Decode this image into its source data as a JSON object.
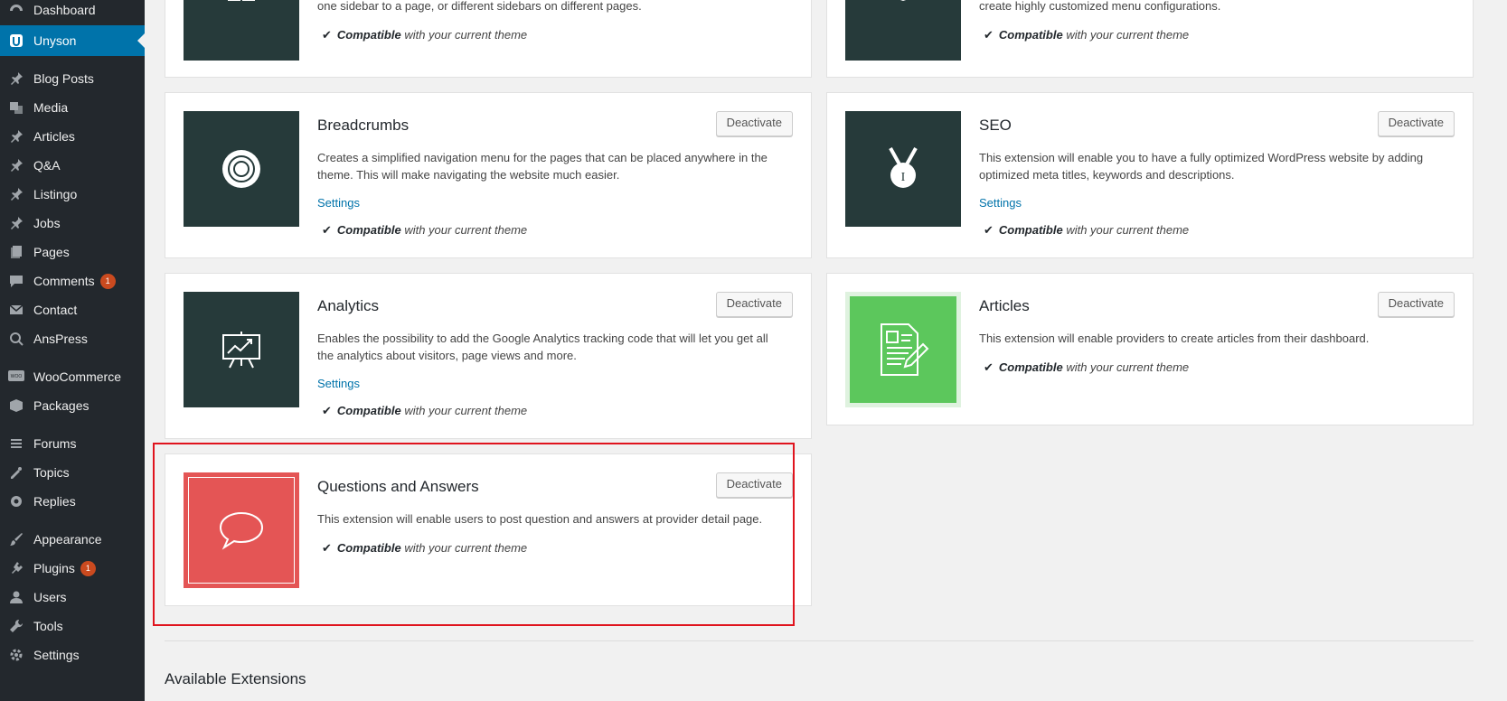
{
  "sidebar": {
    "items": [
      {
        "label": "Dashboard",
        "icon": "dashboard-icon"
      },
      {
        "label": "Unyson",
        "icon": "unyson-icon"
      },
      {
        "label": "Blog Posts",
        "icon": "pin-icon"
      },
      {
        "label": "Media",
        "icon": "media-icon"
      },
      {
        "label": "Articles",
        "icon": "pin-icon"
      },
      {
        "label": "Q&A",
        "icon": "pin-icon"
      },
      {
        "label": "Listingo",
        "icon": "pin-icon"
      },
      {
        "label": "Jobs",
        "icon": "pin-icon"
      },
      {
        "label": "Pages",
        "icon": "pages-icon"
      },
      {
        "label": "Comments",
        "icon": "comments-icon",
        "badge": "1"
      },
      {
        "label": "Contact",
        "icon": "mail-icon"
      },
      {
        "label": "AnsPress",
        "icon": "anspress-icon"
      },
      {
        "label": "WooCommerce",
        "icon": "woocommerce-icon"
      },
      {
        "label": "Packages",
        "icon": "packages-icon"
      },
      {
        "label": "Forums",
        "icon": "forums-icon"
      },
      {
        "label": "Topics",
        "icon": "topics-icon"
      },
      {
        "label": "Replies",
        "icon": "replies-icon"
      },
      {
        "label": "Appearance",
        "icon": "appearance-icon"
      },
      {
        "label": "Plugins",
        "icon": "plugins-icon",
        "badge": "1"
      },
      {
        "label": "Users",
        "icon": "users-icon"
      },
      {
        "label": "Tools",
        "icon": "tools-icon"
      },
      {
        "label": "Settings",
        "icon": "settings-icon"
      }
    ]
  },
  "compat": {
    "bold": "Compatible",
    "rest": " with your current theme"
  },
  "deactivate_label": "Deactivate",
  "settings_label": "Settings",
  "extensions": {
    "sidebars": {
      "desc": "one sidebar to a page, or different sidebars on different pages."
    },
    "megamenu": {
      "desc": "create highly customized menu configurations."
    },
    "breadcrumbs": {
      "title": "Breadcrumbs",
      "desc": "Creates a simplified navigation menu for the pages that can be placed anywhere in the theme. This will make navigating the website much easier."
    },
    "seo": {
      "title": "SEO",
      "desc": "This extension will enable you to have a fully optimized WordPress website by adding optimized meta titles, keywords and descriptions."
    },
    "analytics": {
      "title": "Analytics",
      "desc": "Enables the possibility to add the Google Analytics tracking code that will let you get all the analytics about visitors, page views and more."
    },
    "articles": {
      "title": "Articles",
      "desc": "This extension will enable providers to create articles from their dashboard.",
      "accent": "#5cc75c"
    },
    "qa": {
      "title": "Questions and Answers",
      "desc": "This extension will enable users to post question and answers at provider detail page.",
      "accent": "#e45555"
    }
  },
  "available_heading": "Available Extensions",
  "colors": {
    "sidebar_bg": "#23282d",
    "active": "#0073aa",
    "thumb_dark": "#263a3a",
    "highlight": "#e0141e"
  }
}
